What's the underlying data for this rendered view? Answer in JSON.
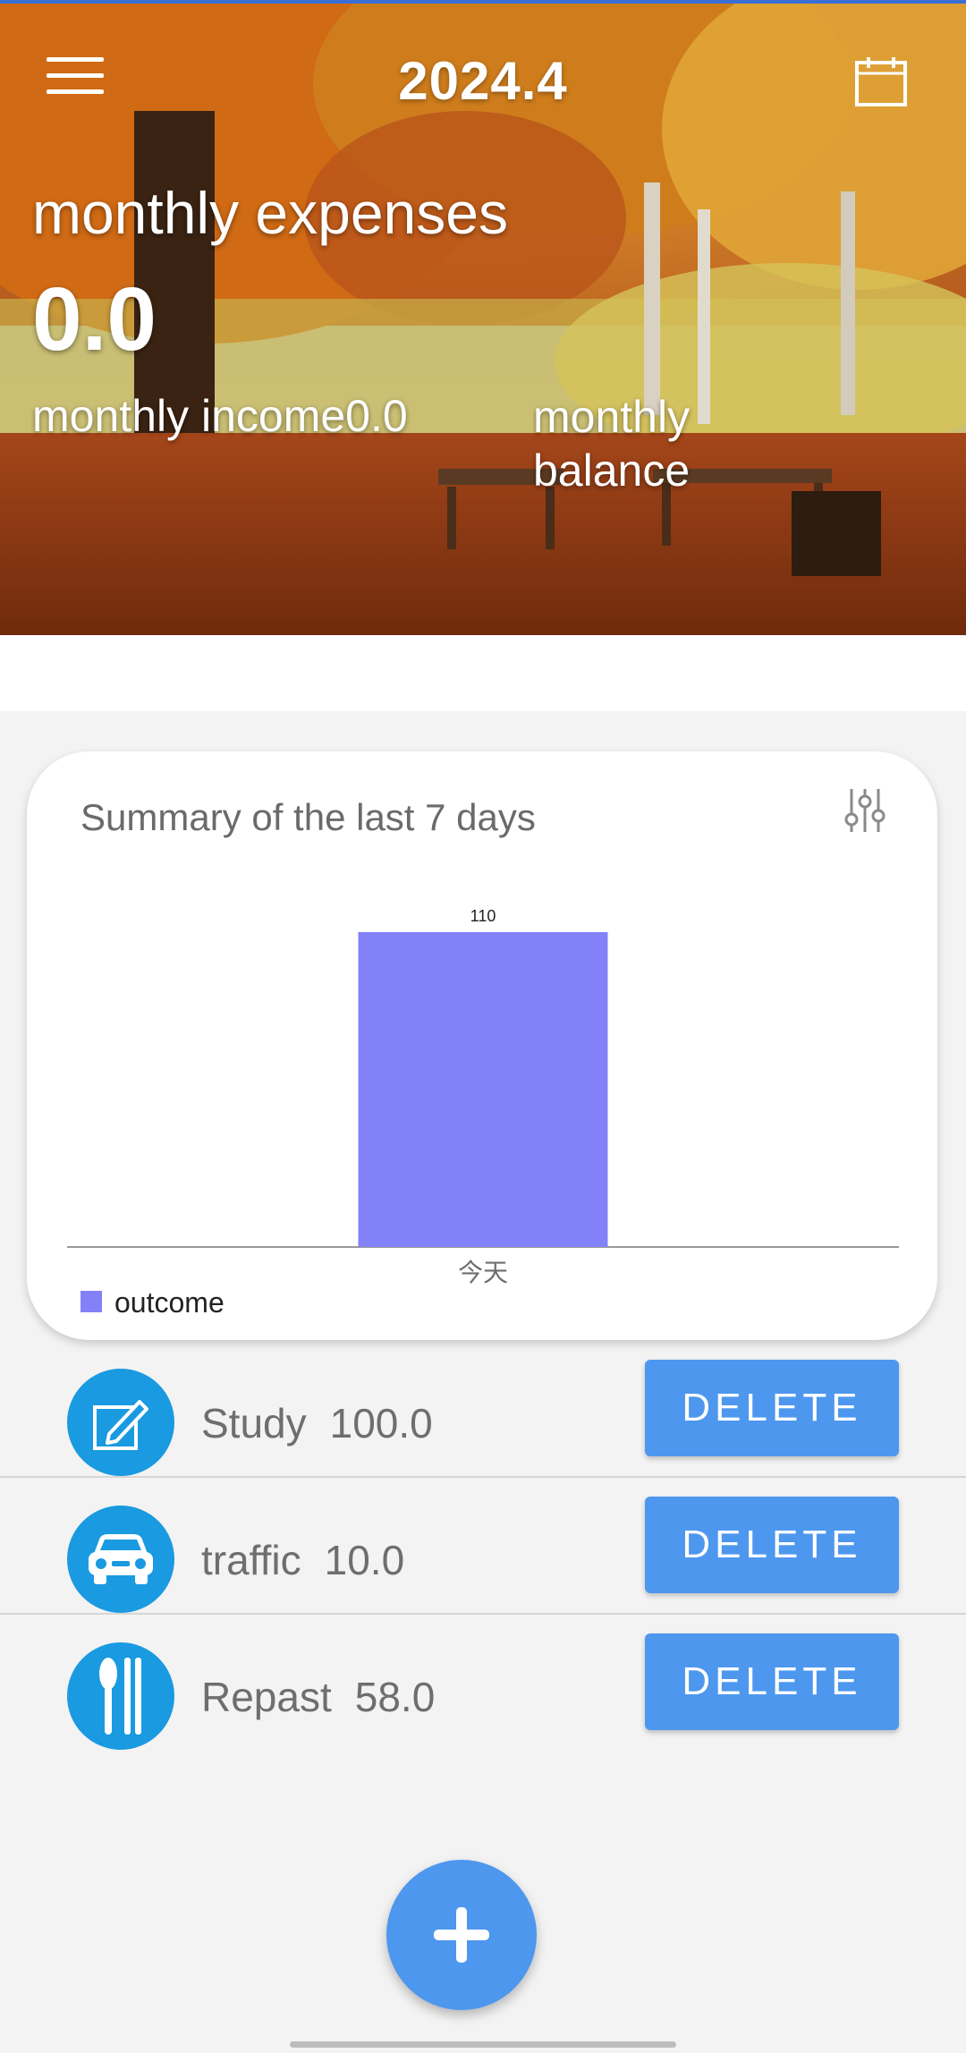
{
  "header": {
    "month": "2024.4",
    "expenses_label": "monthly expenses",
    "expenses_value": "0.0",
    "income_label": "monthly income",
    "income_value": "0.0",
    "balance_label": "monthly balance",
    "menu_icon": "hamburger-menu-icon",
    "calendar_icon": "calendar-icon"
  },
  "summary": {
    "title": "Summary of the last 7 days",
    "settings_icon": "tune-sliders-icon"
  },
  "chart_data": {
    "type": "bar",
    "categories": [
      "今天"
    ],
    "series": [
      {
        "name": "outcome",
        "values": [
          110
        ],
        "color": "#8381f7"
      }
    ],
    "data_labels": [
      "110"
    ],
    "title": "",
    "xlabel": "",
    "ylabel": "",
    "ylim": [
      0,
      130
    ],
    "grid": false,
    "legend": "bottom-left"
  },
  "records": [
    {
      "category": "Study",
      "amount": "100.0",
      "icon": "pencil-note-icon",
      "delete_label": "DELETE"
    },
    {
      "category": "traffic",
      "amount": "10.0",
      "icon": "car-icon",
      "delete_label": "DELETE"
    },
    {
      "category": "Repast",
      "amount": "58.0",
      "icon": "spoon-chopsticks-icon",
      "delete_label": "DELETE"
    }
  ],
  "fab": {
    "icon": "plus-icon"
  },
  "colors": {
    "accent": "#4d97ee",
    "category_icon_bg": "#1a9ae0",
    "bar": "#8381f7"
  }
}
